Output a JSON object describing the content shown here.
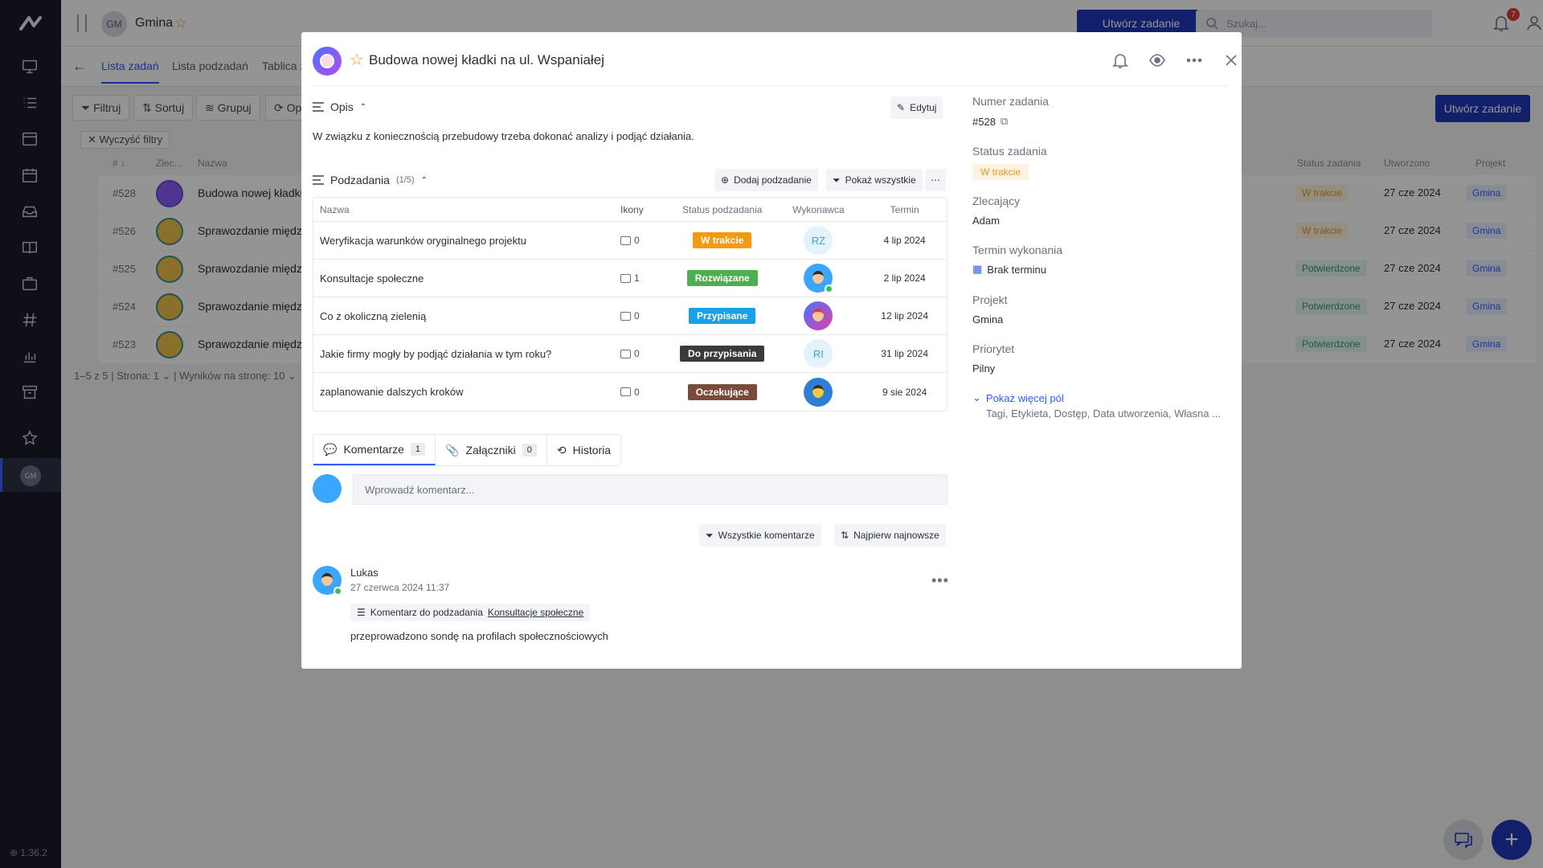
{
  "app": {
    "version": "1.36.2",
    "workspace": {
      "initials": "GM",
      "name": "Gmina"
    },
    "create_task_label": "Utwórz zadanie",
    "search_placeholder": "Szukaj...",
    "notifications_count": "7"
  },
  "view_tabs": [
    "Lista zadań",
    "Lista podzadań",
    "Tablica z"
  ],
  "toolbar": {
    "filter": "Filtruj",
    "sort": "Sortuj",
    "group": "Grupuj",
    "other": "Op",
    "clear_filters": "Wyczyść filtry"
  },
  "task_table": {
    "headers": {
      "num": "# ↓",
      "assigner": "Zlec...",
      "name": "Nazwa",
      "status": "Status zadania",
      "created": "Utworzono",
      "project": "Projekt"
    },
    "rows": [
      {
        "num": "#528",
        "name": "Budowa nowej kładki",
        "status": "W trakcie",
        "created": "27 cze 2024",
        "project": "Gmina"
      },
      {
        "num": "#526",
        "name": "Sprawozdanie między",
        "status": "W trakcie",
        "created": "27 cze 2024",
        "project": "Gmina"
      },
      {
        "num": "#525",
        "name": "Sprawozdanie między",
        "status": "Potwierdzone",
        "created": "27 cze 2024",
        "project": "Gmina"
      },
      {
        "num": "#524",
        "name": "Sprawozdanie między",
        "status": "Potwierdzone",
        "created": "27 cze 2024",
        "project": "Gmina"
      },
      {
        "num": "#523",
        "name": "Sprawozdanie między",
        "status": "Potwierdzone",
        "created": "27 cze 2024",
        "project": "Gmina"
      }
    ],
    "pager": "1–5 z 5  |  Strona: 1 ⌄  |  Wyników na stronę: 10 ⌄"
  },
  "modal": {
    "title": "Budowa nowej kładki na ul. Wspaniałej",
    "description": {
      "heading": "Opis",
      "edit_label": "Edytuj",
      "text": "W związku z koniecznością przebudowy trzeba dokonać analizy i podjąć działania."
    },
    "subtasks": {
      "heading": "Podzadania",
      "count": "(1/5)",
      "add_label": "Dodaj podzadanie",
      "show_all_label": "Pokaż wszystkie",
      "headers": {
        "name": "Nazwa",
        "icons": "Ikony",
        "status": "Status podzadania",
        "assignee": "Wykonawca",
        "due": "Termin"
      },
      "rows": [
        {
          "name": "Weryfikacja warunków oryginalnego projektu",
          "comments": "0",
          "status": "W trakcie",
          "status_color": "#f39a12",
          "assignee": "RZ",
          "due": "4 lip 2024"
        },
        {
          "name": "Konsultacje społeczne",
          "comments": "1",
          "status": "Rozwiązane",
          "status_color": "#4caf50",
          "assignee": "",
          "due": "2 lip 2024"
        },
        {
          "name": "Co z okoliczną zielenią",
          "comments": "0",
          "status": "Przypisane",
          "status_color": "#1aa0e8",
          "assignee": "",
          "due": "12 lip 2024"
        },
        {
          "name": "Jakie firmy mogły by podjąć działania w tym roku?",
          "comments": "0",
          "status": "Do przypisania",
          "status_color": "#3a3a3a",
          "assignee": "RI",
          "due": "31 lip 2024"
        },
        {
          "name": "zaplanowanie dalszych kroków",
          "comments": "0",
          "status": "Oczekujące",
          "status_color": "#7a4a3a",
          "assignee": "",
          "due": "9 sie 2024"
        }
      ]
    },
    "tabs": [
      {
        "label": "Komentarze",
        "count": "1"
      },
      {
        "label": "Załączniki",
        "count": "0"
      },
      {
        "label": "Historia",
        "count": ""
      }
    ],
    "comment_placeholder": "Wprowadź komentarz...",
    "filters": {
      "all_comments": "Wszystkie komentarze",
      "newest_first": "Najpierw najnowsze"
    },
    "comment": {
      "author": "Lukas",
      "date": "27 czerwca 2024 11:37",
      "ref_prefix": "Komentarz do podzadania",
      "ref_link": "Konsultacje społeczne",
      "text": "przeprowadzono sondę na profilach społecznościowych"
    },
    "fields": {
      "number_label": "Numer zadania",
      "number": "#528",
      "status_label": "Status zadania",
      "status": "W trakcie",
      "assigner_label": "Zlecający",
      "assigner": "Adam",
      "due_label": "Termin wykonania",
      "due": "Brak terminu",
      "project_label": "Projekt",
      "project": "Gmina",
      "priority_label": "Priorytet",
      "priority": "Pilny",
      "more_label": "Pokaż więcej pól",
      "more_list": "Tagi, Etykieta, Dostęp, Data utworzenia, Własna ..."
    }
  }
}
